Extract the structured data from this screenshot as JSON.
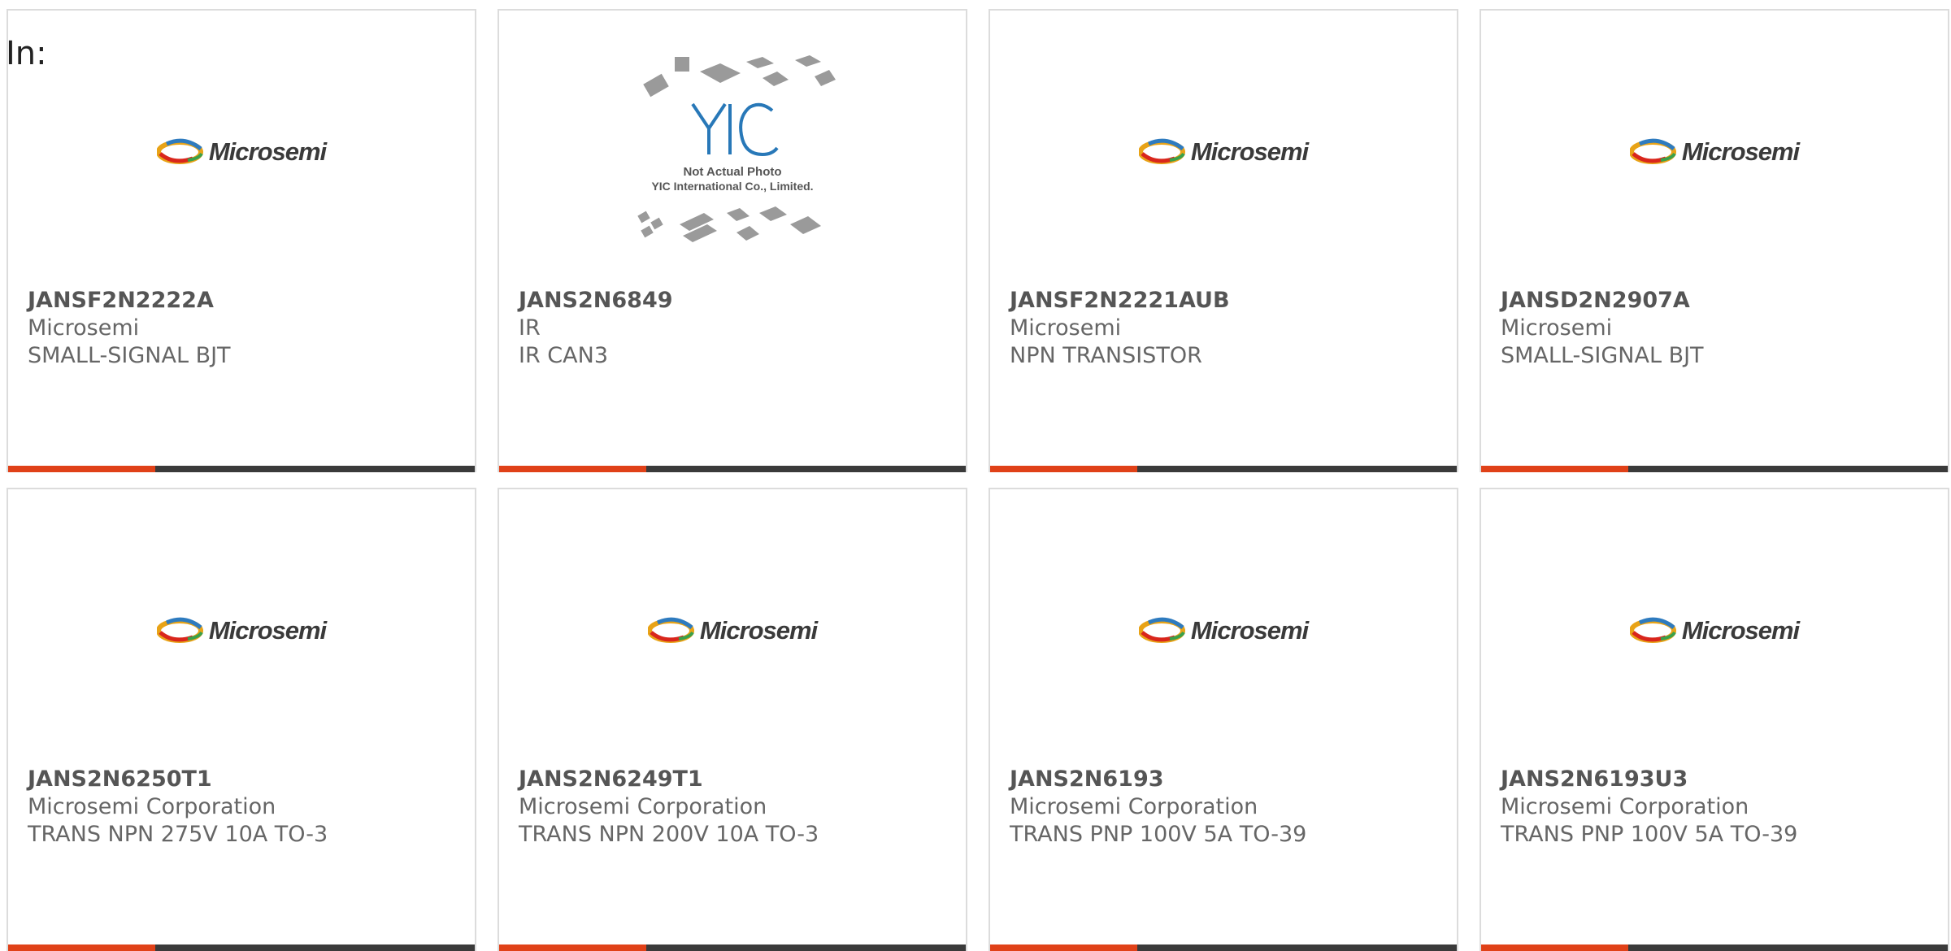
{
  "page": {
    "label": "In:"
  },
  "colors": {
    "accent": "#e04118",
    "bar": "#3a3a3a",
    "border": "#dcdcdc"
  },
  "products": [
    {
      "part": "JANSF2N2222A",
      "mfr": "Microsemi",
      "desc": "SMALL-SIGNAL BJT",
      "image": "microsemi-logo"
    },
    {
      "part": "JANS2N6849",
      "mfr": "IR",
      "desc": "IR CAN3",
      "image": "placeholder-photo"
    },
    {
      "part": "JANSF2N2221AUB",
      "mfr": "Microsemi",
      "desc": "NPN TRANSISTOR",
      "image": "microsemi-logo"
    },
    {
      "part": "JANSD2N2907A",
      "mfr": "Microsemi",
      "desc": "SMALL-SIGNAL BJT",
      "image": "microsemi-logo"
    },
    {
      "part": "JANS2N6250T1",
      "mfr": "Microsemi Corporation",
      "desc": "TRANS NPN 275V 10A TO-3",
      "image": "microsemi-logo"
    },
    {
      "part": "JANS2N6249T1",
      "mfr": "Microsemi Corporation",
      "desc": "TRANS NPN 200V 10A TO-3",
      "image": "microsemi-logo"
    },
    {
      "part": "JANS2N6193",
      "mfr": "Microsemi Corporation",
      "desc": "TRANS PNP 100V 5A TO-39",
      "image": "microsemi-logo"
    },
    {
      "part": "JANS2N6193U3",
      "mfr": "Microsemi Corporation",
      "desc": "TRANS PNP 100V 5A TO-39",
      "image": "microsemi-logo"
    }
  ],
  "logos": {
    "microsemi": "Microsemi",
    "placeholder_line1": "Not Actual Photo",
    "placeholder_line2": "YIC International Co., Limited.",
    "placeholder_mark": "YIC"
  }
}
